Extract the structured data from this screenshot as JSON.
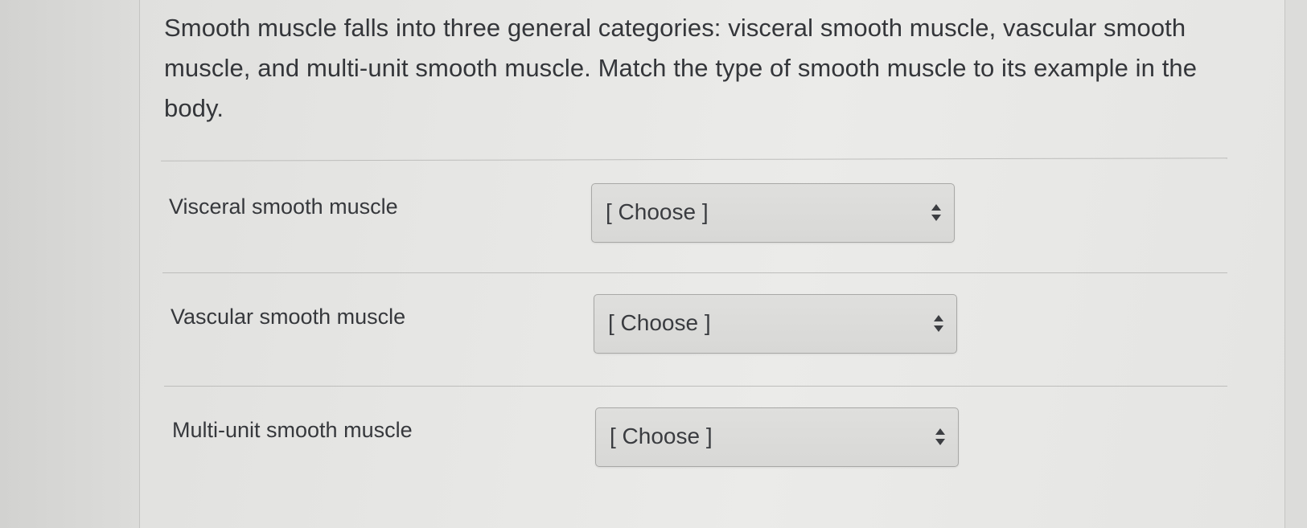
{
  "question": {
    "text": "Smooth muscle falls into three general categories: visceral smooth muscle, vascular smooth muscle, and multi-unit smooth muscle. Match the type of smooth muscle to its example in the body."
  },
  "rows": [
    {
      "label": "Visceral smooth muscle",
      "selected": "[ Choose ]"
    },
    {
      "label": "Vascular smooth muscle",
      "selected": "[ Choose ]"
    },
    {
      "label": "Multi-unit smooth muscle",
      "selected": "[ Choose ]"
    }
  ],
  "icons": {
    "select_arrows": "up-down-arrows-icon"
  },
  "colors": {
    "text": "#34363a",
    "divider": "#bdbdbb",
    "select_border": "#a8a8a6"
  }
}
